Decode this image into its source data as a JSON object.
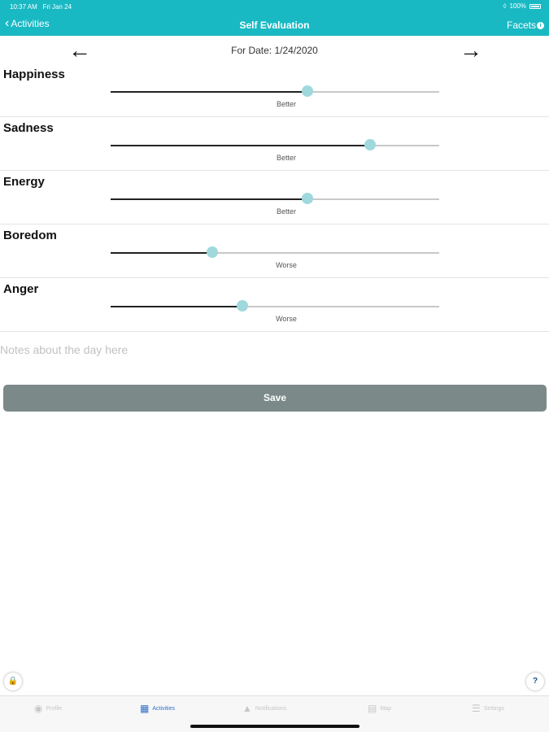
{
  "status": {
    "time": "10:37 AM",
    "date": "Fri Jan 24",
    "battery": "100%"
  },
  "nav": {
    "back_label": "Activities",
    "title": "Self Evaluation",
    "right_label": "Facets",
    "right_icon": "info-icon"
  },
  "date_row": {
    "label": "For Date: 1/24/2020",
    "prev_icon": "arrow-left-icon",
    "next_icon": "arrow-right-icon"
  },
  "facets": [
    {
      "name": "Happiness",
      "value": 0.6,
      "hint": "Better"
    },
    {
      "name": "Sadness",
      "value": 0.79,
      "hint": "Better"
    },
    {
      "name": "Energy",
      "value": 0.6,
      "hint": "Better"
    },
    {
      "name": "Boredom",
      "value": 0.31,
      "hint": "Worse"
    },
    {
      "name": "Anger",
      "value": 0.4,
      "hint": "Worse"
    }
  ],
  "notes": {
    "placeholder": "Notes about the day here",
    "value": ""
  },
  "save_label": "Save",
  "floating": {
    "lock_icon": "lock-icon",
    "help_label": "?"
  },
  "tabs": [
    {
      "label": "Profile",
      "icon": "profile-icon",
      "active": false
    },
    {
      "label": "Activities",
      "icon": "calendar-icon",
      "active": true
    },
    {
      "label": "Notifications",
      "icon": "bell-icon",
      "active": false
    },
    {
      "label": "Map",
      "icon": "map-icon",
      "active": false
    },
    {
      "label": "Settings",
      "icon": "settings-icon",
      "active": false
    }
  ],
  "colors": {
    "accent": "#19b9c4",
    "thumb": "#9fd8dd",
    "save": "#7b8a88",
    "tab_active": "#2f6fc9"
  }
}
